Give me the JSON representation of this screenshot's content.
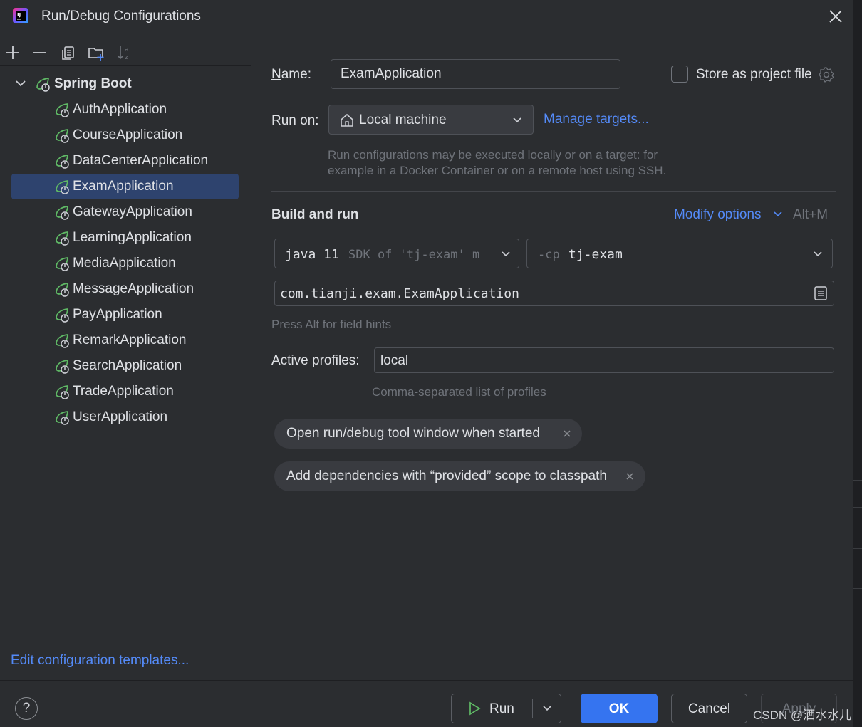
{
  "window": {
    "title": "Run/Debug Configurations"
  },
  "toolbar": {
    "icons": [
      "add-icon",
      "remove-icon",
      "copy-icon",
      "new-folder-icon",
      "sort-icon"
    ]
  },
  "tree": {
    "group_label": "Spring Boot",
    "items": [
      {
        "label": "AuthApplication",
        "selected": false
      },
      {
        "label": "CourseApplication",
        "selected": false
      },
      {
        "label": "DataCenterApplication",
        "selected": false
      },
      {
        "label": "ExamApplication",
        "selected": true
      },
      {
        "label": "GatewayApplication",
        "selected": false
      },
      {
        "label": "LearningApplication",
        "selected": false
      },
      {
        "label": "MediaApplication",
        "selected": false
      },
      {
        "label": "MessageApplication",
        "selected": false
      },
      {
        "label": "PayApplication",
        "selected": false
      },
      {
        "label": "RemarkApplication",
        "selected": false
      },
      {
        "label": "SearchApplication",
        "selected": false
      },
      {
        "label": "TradeApplication",
        "selected": false
      },
      {
        "label": "UserApplication",
        "selected": false
      }
    ],
    "edit_templates_link": "Edit configuration templates..."
  },
  "form": {
    "name_label_first": "N",
    "name_label_rest": "ame:",
    "name_value": "ExamApplication",
    "store_label": "Store as project file",
    "store_checked": false,
    "run_on_label": "Run on:",
    "run_on_value": "Local machine",
    "manage_targets": "Manage targets...",
    "run_on_hint_1": "Run configurations may be executed locally or on a target: for",
    "run_on_hint_2": "example in a Docker Container or on a remote host using SSH.",
    "build_run_title": "Build and run",
    "modify_options": "Modify options",
    "modify_shortcut": "Alt+M",
    "sdk_java": "java 11",
    "sdk_hint": "SDK of 'tj-exam' m",
    "cp_flag": "-cp",
    "cp_value": "tj-exam",
    "main_class": "com.tianji.exam.ExamApplication",
    "field_hints": "Press Alt for field hints",
    "profiles_label": "Active profiles:",
    "profiles_value": "local",
    "profiles_hint": "Comma-separated list of profiles",
    "chips": [
      "Open run/debug tool window when started",
      "Add dependencies with “provided” scope to classpath"
    ]
  },
  "buttons": {
    "help": "?",
    "run": "Run",
    "ok": "OK",
    "cancel": "Cancel",
    "apply": "Apply"
  },
  "watermark": "CSDN @洒水水儿",
  "colors": {
    "background": "#2b2d30",
    "selection": "#2e436e",
    "link": "#548af7",
    "primary_button": "#3574f0",
    "spring_icon": "#5fb865"
  }
}
